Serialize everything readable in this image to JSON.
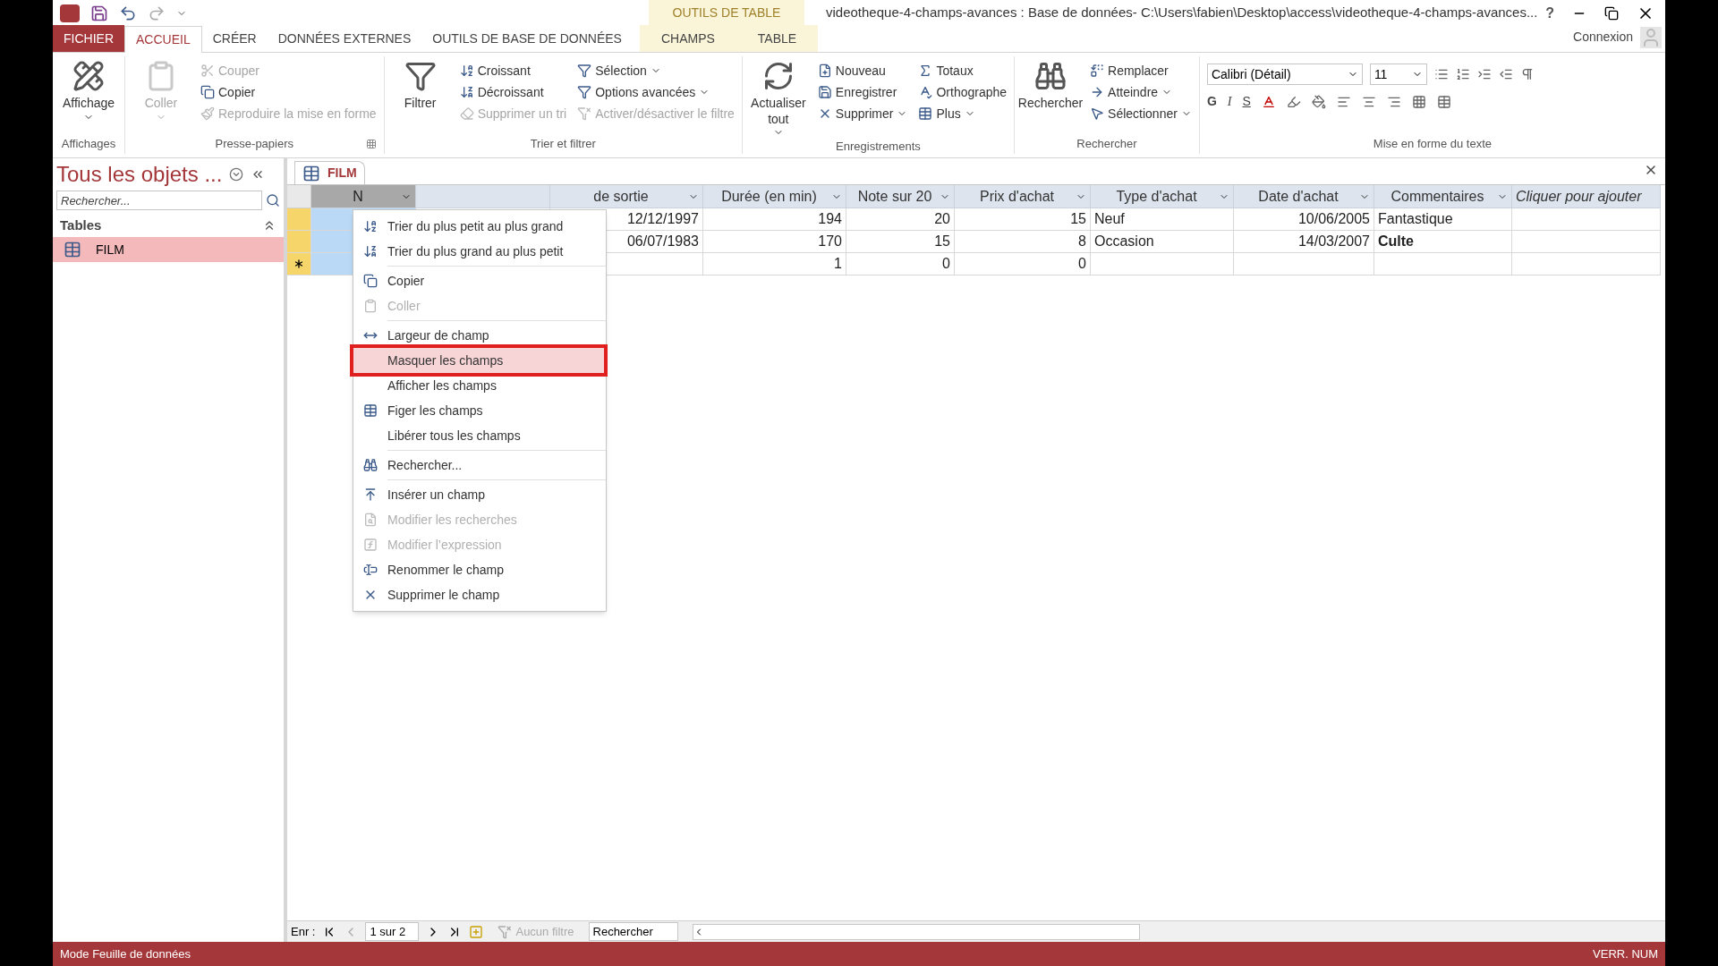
{
  "window": {
    "contextual_label": "OUTILS DE TABLE",
    "title": "videotheque-4-champs-avances : Base de données- C:\\Users\\fabien\\Desktop\\access\\videotheque-4-champs-avances...",
    "help": "?",
    "account": "Connexion"
  },
  "tabs": [
    {
      "label": "FICHIER",
      "kind": "file",
      "selected": false
    },
    {
      "label": "ACCUEIL",
      "kind": "normal",
      "selected": true
    },
    {
      "label": "CRÉER",
      "kind": "normal",
      "selected": false
    },
    {
      "label": "DONNÉES EXTERNES",
      "kind": "normal",
      "selected": false
    },
    {
      "label": "OUTILS DE BASE DE DONNÉES",
      "kind": "normal",
      "selected": false
    },
    {
      "label": "CHAMPS",
      "kind": "contextual",
      "selected": false
    },
    {
      "label": "TABLE",
      "kind": "contextual",
      "selected": false
    }
  ],
  "ribbon": [
    {
      "label": "Affichages",
      "launcher": false,
      "large": [
        {
          "label": "Affichage",
          "disabled": false,
          "dropdown": true
        }
      ]
    },
    {
      "label": "Presse-papiers",
      "launcher": true,
      "large": [
        {
          "label": "Coller",
          "disabled": true,
          "dropdown": true
        }
      ],
      "columns": [
        [
          {
            "label": "Couper",
            "disabled": true,
            "dropdown": false
          },
          {
            "label": "Copier",
            "disabled": false,
            "dropdown": false
          },
          {
            "label": "Reproduire la mise en forme",
            "disabled": true,
            "dropdown": false
          }
        ]
      ]
    },
    {
      "label": "Trier et filtrer",
      "launcher": false,
      "large": [
        {
          "label": "Filtrer",
          "disabled": false,
          "dropdown": false
        }
      ],
      "columns": [
        [
          {
            "label": "Croissant",
            "disabled": false,
            "dropdown": false
          },
          {
            "label": "Décroissant",
            "disabled": false,
            "dropdown": false
          },
          {
            "label": "Supprimer un tri",
            "disabled": true,
            "dropdown": false
          }
        ],
        [
          {
            "label": "Sélection",
            "disabled": false,
            "dropdown": true
          },
          {
            "label": "Options avancées",
            "disabled": false,
            "dropdown": true
          },
          {
            "label": "Activer/désactiver le filtre",
            "disabled": true,
            "dropdown": false
          }
        ]
      ]
    },
    {
      "label": "Enregistrements",
      "launcher": false,
      "large": [
        {
          "label": "Actualiser tout",
          "disabled": false,
          "dropdown": true
        }
      ],
      "columns": [
        [
          {
            "label": "Nouveau",
            "disabled": false,
            "dropdown": false
          },
          {
            "label": "Enregistrer",
            "disabled": false,
            "dropdown": false
          },
          {
            "label": "Supprimer",
            "disabled": false,
            "dropdown": true
          }
        ],
        [
          {
            "label": "Totaux",
            "disabled": false,
            "dropdown": false
          },
          {
            "label": "Orthographe",
            "disabled": false,
            "dropdown": false
          },
          {
            "label": "Plus",
            "disabled": false,
            "dropdown": true
          }
        ]
      ]
    },
    {
      "label": "Rechercher",
      "launcher": false,
      "large": [
        {
          "label": "Rechercher",
          "disabled": false,
          "dropdown": false
        }
      ],
      "columns": [
        [
          {
            "label": "Remplacer",
            "disabled": false,
            "dropdown": false
          },
          {
            "label": "Atteindre",
            "disabled": false,
            "dropdown": true
          },
          {
            "label": "Sélectionner",
            "disabled": false,
            "dropdown": true
          }
        ]
      ]
    }
  ],
  "text_format": {
    "label": "Mise en forme du texte",
    "font": "Calibri (Détail)",
    "size": "11",
    "bold": "G",
    "italic": "I",
    "underline": "S"
  },
  "navigation": {
    "title": "Tous les objets ...",
    "search": {
      "placeholder": "Rechercher..."
    },
    "section": "Tables",
    "items": [
      {
        "label": "FILM",
        "selected": true
      }
    ]
  },
  "document_tab": {
    "label": "FILM"
  },
  "table": {
    "columns": [
      {
        "label": "N",
        "selected": true
      },
      {
        "selected": false
      },
      {
        "label": "de sortie",
        "selected": false
      },
      {
        "label": "Durée (en min)",
        "selected": false
      },
      {
        "label": "Note sur 20",
        "selected": false
      },
      {
        "label": "Prix d'achat",
        "selected": false
      },
      {
        "label": "Type d'achat",
        "selected": false
      },
      {
        "label": "Date d'achat",
        "selected": false
      },
      {
        "label": "Commentaires",
        "selected": false
      },
      {
        "label": "Cliquer pour ajouter",
        "kind": "add",
        "selected": false
      }
    ],
    "rows": [
      {
        "kind": "record",
        "cells": [
          null,
          null,
          "12/12/1997",
          "194",
          "20",
          "15",
          "Neuf",
          "10/06/2005",
          "Fantastique",
          null
        ]
      },
      {
        "kind": "record",
        "cells": [
          null,
          null,
          "06/07/1983",
          "170",
          "15",
          "8",
          "Occasion",
          "14/03/2007",
          {
            "text": "Culte",
            "bold": true
          },
          null
        ]
      },
      {
        "kind": "new",
        "cells": [
          null,
          null,
          null,
          "1",
          "0",
          "0",
          null,
          null,
          null,
          null
        ]
      }
    ]
  },
  "context_menu": [
    {
      "label": "Trier du plus petit au plus grand",
      "disabled": false,
      "selected": false
    },
    {
      "label": "Trier du plus grand au plus petit",
      "disabled": false,
      "selected": false,
      "separator_after": true
    },
    {
      "label": "Copier",
      "disabled": false,
      "selected": false
    },
    {
      "label": "Coller",
      "disabled": true,
      "selected": false,
      "separator_after": true
    },
    {
      "label": "Largeur de champ",
      "disabled": false,
      "selected": false
    },
    {
      "label": "Masquer les champs",
      "disabled": false,
      "selected": true
    },
    {
      "label": "Afficher les champs",
      "disabled": false,
      "selected": false
    },
    {
      "label": "Figer les champs",
      "disabled": false,
      "selected": false
    },
    {
      "label": "Libérer tous les champs",
      "disabled": false,
      "selected": false,
      "separator_after": true
    },
    {
      "label": "Rechercher...",
      "disabled": false,
      "selected": false,
      "separator_after": true
    },
    {
      "label": "Insérer un champ",
      "disabled": false,
      "selected": false
    },
    {
      "label": "Modifier les recherches",
      "disabled": true,
      "selected": false
    },
    {
      "label": "Modifier l’expression",
      "disabled": true,
      "selected": false
    },
    {
      "label": "Renommer le champ",
      "disabled": false,
      "selected": false
    },
    {
      "label": "Supprimer le champ",
      "disabled": false,
      "selected": false
    }
  ],
  "record_navigator": {
    "label": "Enr :",
    "position": "1 sur 2",
    "filter": "Aucun filtre",
    "search": "Rechercher"
  },
  "status_bar": {
    "mode": "Mode Feuille de données",
    "indicator": "VERR. NUM"
  }
}
